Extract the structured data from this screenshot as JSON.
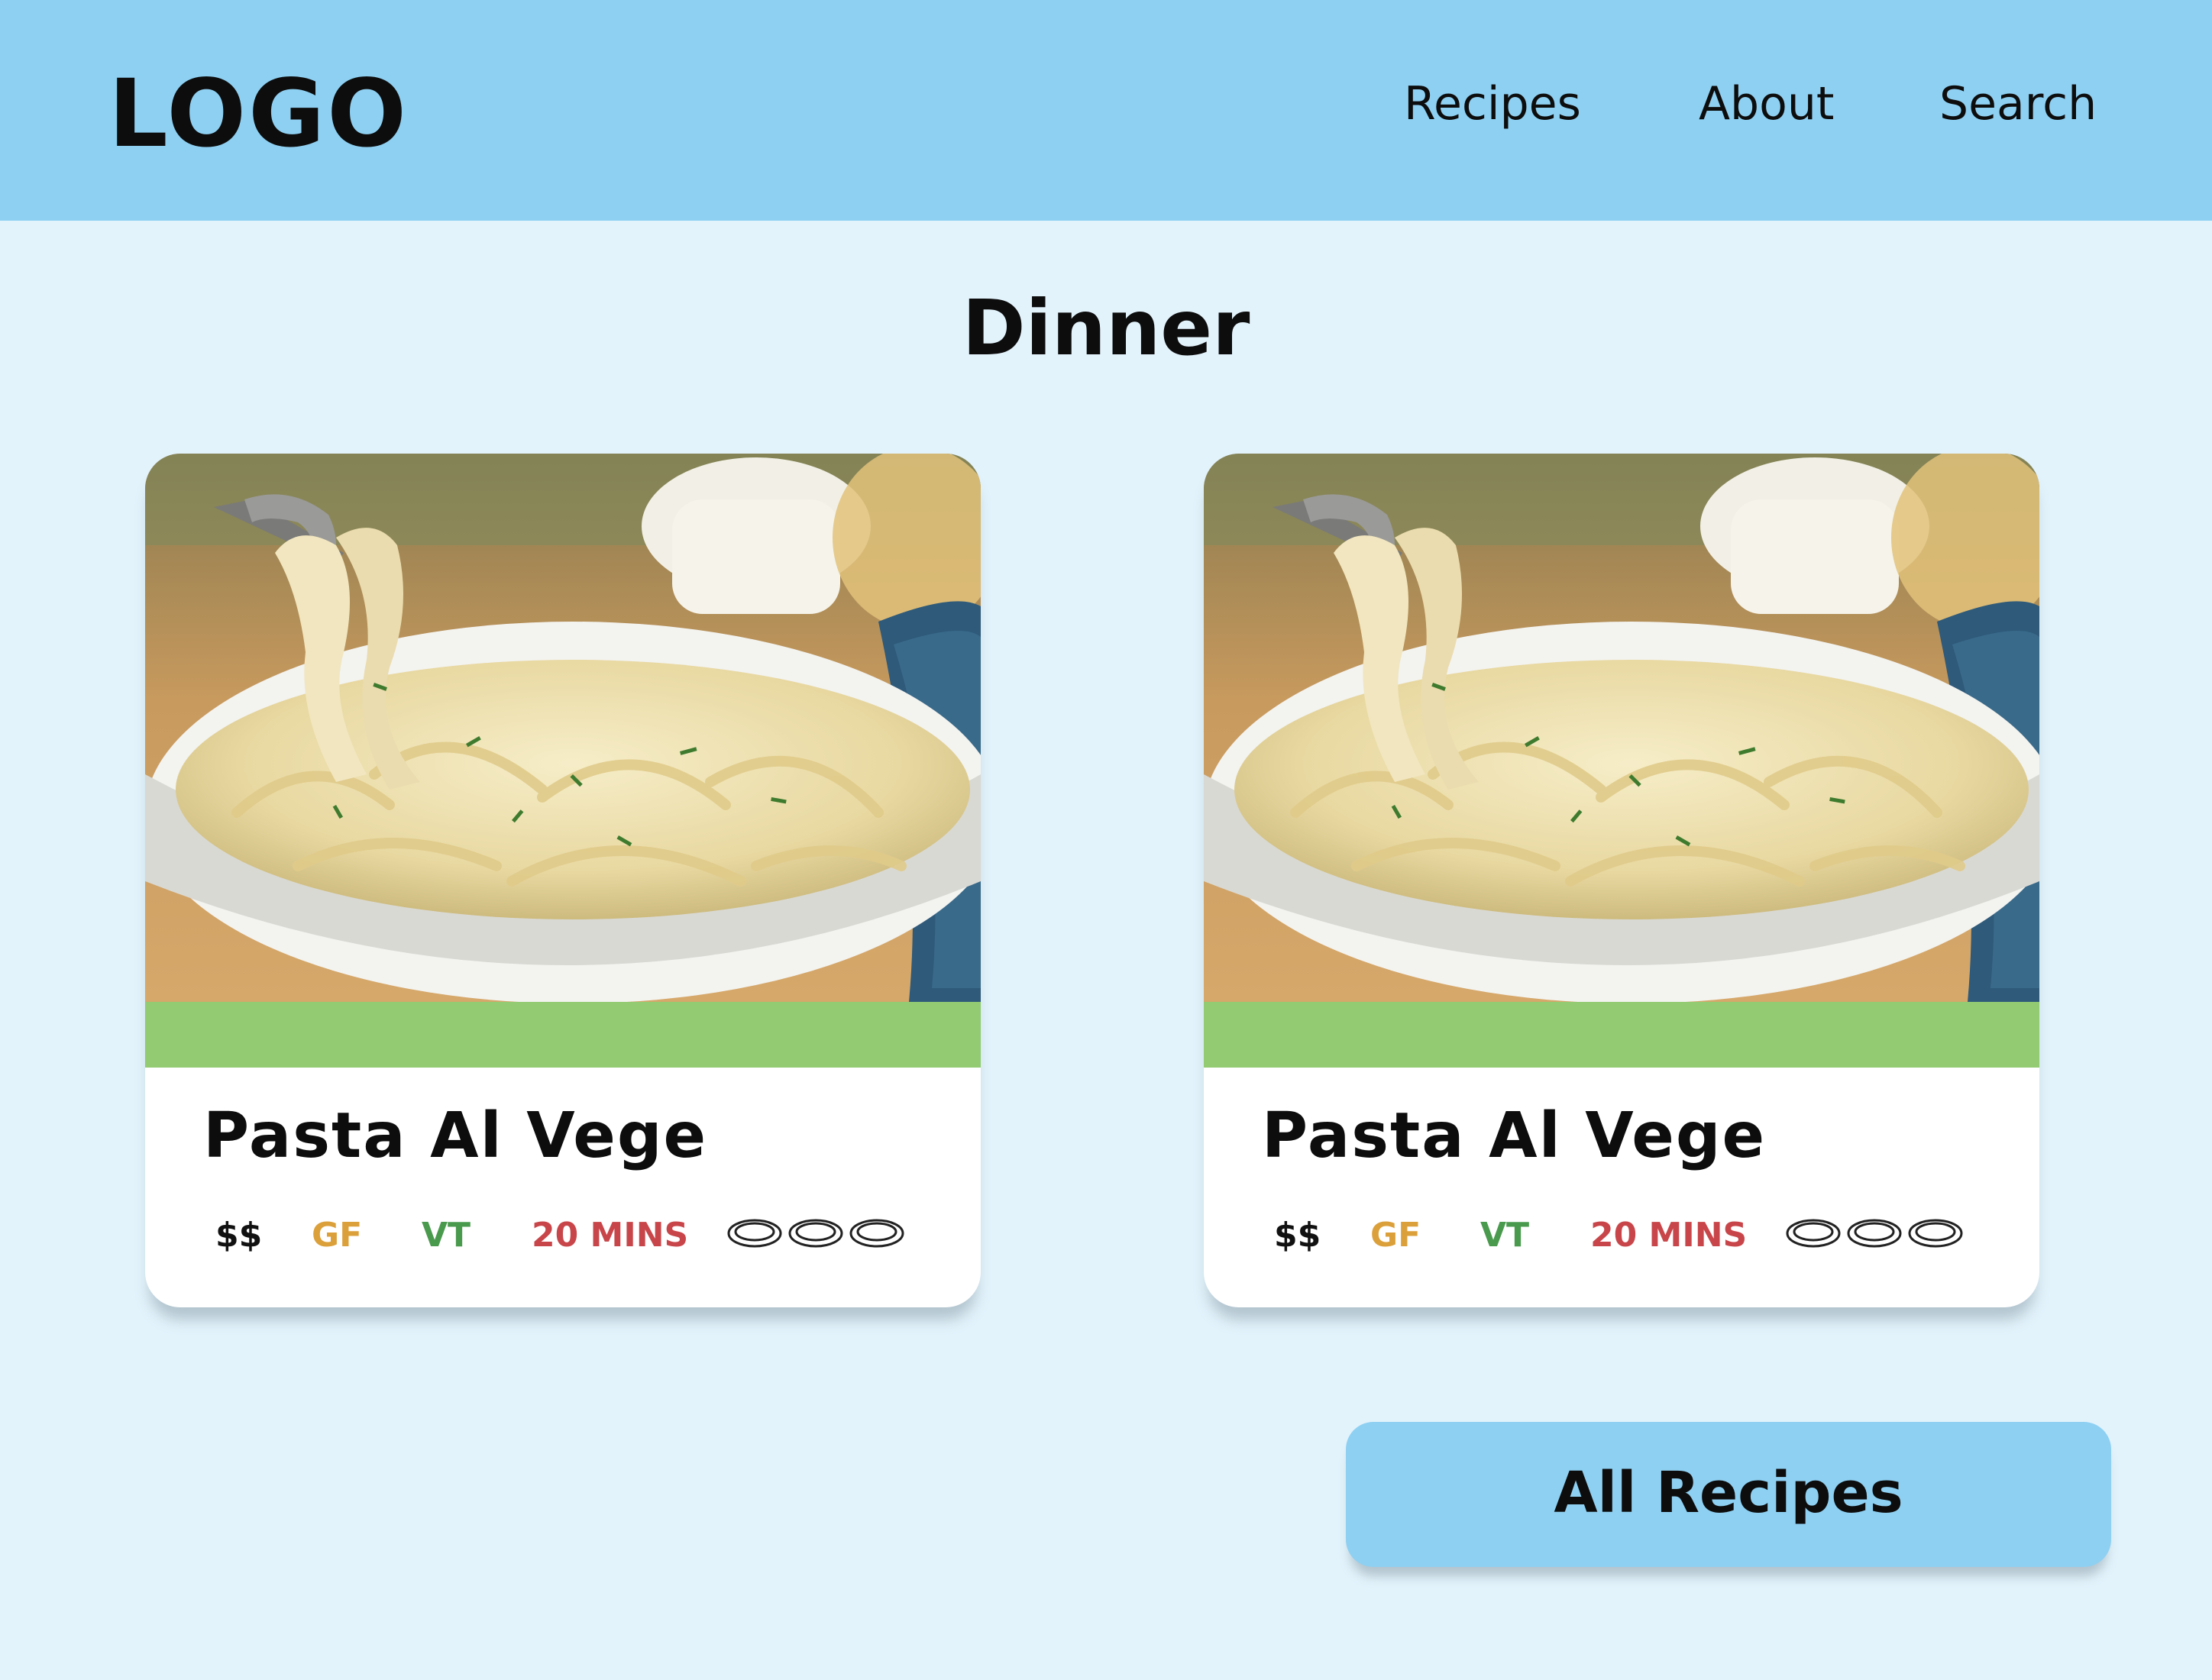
{
  "header": {
    "logo": "LOGO",
    "nav": [
      "Recipes",
      "About",
      "Search"
    ]
  },
  "page": {
    "title": "Dinner"
  },
  "cards": [
    {
      "title": "Pasta Al Vege",
      "price": "$$",
      "tag_gf": "GF",
      "tag_vt": "VT",
      "time": "20 MINS",
      "servings_icon": "plate-icon",
      "servings_count": 3,
      "image": "fettuccine-alfredo-photo"
    },
    {
      "title": "Pasta Al Vege",
      "price": "$$",
      "tag_gf": "GF",
      "tag_vt": "VT",
      "time": "20 MINS",
      "servings_icon": "plate-icon",
      "servings_count": 3,
      "image": "fettuccine-alfredo-photo"
    }
  ],
  "button": {
    "label": "All Recipes"
  },
  "colors": {
    "header_bg": "#8ed0f2",
    "page_bg": "#e3f3fc",
    "card_band": "#92cb72",
    "price": "#111111",
    "gf": "#dba03a",
    "vt": "#4a9a4e",
    "time": "#c8464a",
    "button_bg": "#8ed0f2"
  }
}
